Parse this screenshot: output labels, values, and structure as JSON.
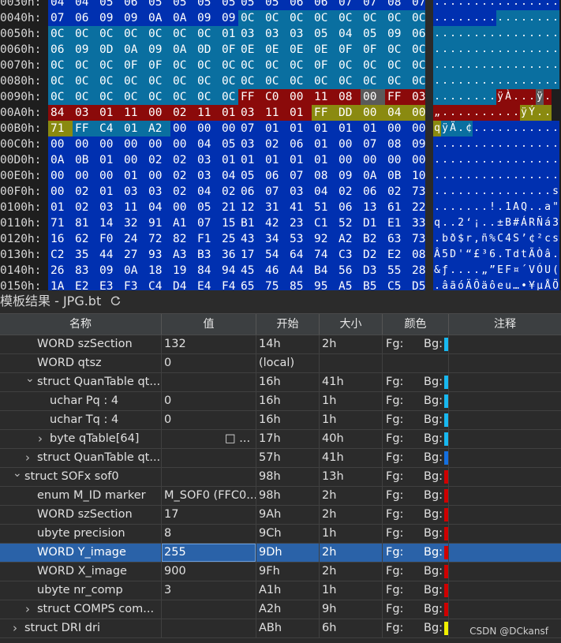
{
  "colors": {
    "blue": "#0030b0",
    "teal": "#0a6fa0",
    "red": "#8b0a0a",
    "yellow": "#8a8a10",
    "gray": "#5a5a5a",
    "swatch_cyan": "#18b8f0",
    "swatch_blue": "#1470e0",
    "swatch_red": "#d00000",
    "swatch_yellow": "#f0f000"
  },
  "hex": {
    "rows": [
      {
        "addr": "0030h:",
        "bytes": [
          "04",
          "04",
          "05",
          "06",
          "05",
          "05",
          "05",
          "05",
          "05",
          "05",
          "06",
          "06",
          "07",
          "07",
          "08",
          "07"
        ],
        "ascii": "................"
      },
      {
        "addr": "0040h:",
        "bytes": [
          "07",
          "06",
          "09",
          "09",
          "0A",
          "0A",
          "09",
          "09",
          "0C",
          "0C",
          "0C",
          "0C",
          "0C",
          "0C",
          "0C",
          "0C"
        ],
        "ascii": "................"
      },
      {
        "addr": "0050h:",
        "bytes": [
          "0C",
          "0C",
          "0C",
          "0C",
          "0C",
          "0C",
          "0C",
          "01",
          "03",
          "03",
          "03",
          "05",
          "04",
          "05",
          "09",
          "06"
        ],
        "ascii": "................"
      },
      {
        "addr": "0060h:",
        "bytes": [
          "06",
          "09",
          "0D",
          "0A",
          "09",
          "0A",
          "0D",
          "0F",
          "0E",
          "0E",
          "0E",
          "0E",
          "0F",
          "0F",
          "0C",
          "0C"
        ],
        "ascii": "................"
      },
      {
        "addr": "0070h:",
        "bytes": [
          "0C",
          "0C",
          "0C",
          "0F",
          "0F",
          "0C",
          "0C",
          "0C",
          "0C",
          "0C",
          "0C",
          "0F",
          "0C",
          "0C",
          "0C",
          "0C"
        ],
        "ascii": "................"
      },
      {
        "addr": "0080h:",
        "bytes": [
          "0C",
          "0C",
          "0C",
          "0C",
          "0C",
          "0C",
          "0C",
          "0C",
          "0C",
          "0C",
          "0C",
          "0C",
          "0C",
          "0C",
          "0C",
          "0C"
        ],
        "ascii": "................"
      },
      {
        "addr": "0090h:",
        "bytes": [
          "0C",
          "0C",
          "0C",
          "0C",
          "0C",
          "0C",
          "0C",
          "0C",
          "FF",
          "C0",
          "00",
          "11",
          "08",
          "00",
          "FF",
          "03"
        ],
        "ascii": "........ÿÀ...ÿ."
      },
      {
        "addr": "00A0h:",
        "bytes": [
          "84",
          "03",
          "01",
          "11",
          "00",
          "02",
          "11",
          "01",
          "03",
          "11",
          "01",
          "FF",
          "DD",
          "00",
          "04",
          "00"
        ],
        "ascii": "„..........ÿÝ.."
      },
      {
        "addr": "00B0h:",
        "bytes": [
          "71",
          "FF",
          "C4",
          "01",
          "A2",
          "00",
          "00",
          "00",
          "07",
          "01",
          "01",
          "01",
          "01",
          "01",
          "00",
          "00"
        ],
        "ascii": "qÿÄ.¢..........."
      },
      {
        "addr": "00C0h:",
        "bytes": [
          "00",
          "00",
          "00",
          "00",
          "00",
          "00",
          "04",
          "05",
          "03",
          "02",
          "06",
          "01",
          "00",
          "07",
          "08",
          "09"
        ],
        "ascii": "................"
      },
      {
        "addr": "00D0h:",
        "bytes": [
          "0A",
          "0B",
          "01",
          "00",
          "02",
          "02",
          "03",
          "01",
          "01",
          "01",
          "01",
          "01",
          "00",
          "00",
          "00",
          "00"
        ],
        "ascii": "................"
      },
      {
        "addr": "00E0h:",
        "bytes": [
          "00",
          "00",
          "00",
          "01",
          "00",
          "02",
          "03",
          "04",
          "05",
          "06",
          "07",
          "08",
          "09",
          "0A",
          "0B",
          "10"
        ],
        "ascii": "................"
      },
      {
        "addr": "00F0h:",
        "bytes": [
          "00",
          "02",
          "01",
          "03",
          "03",
          "02",
          "04",
          "02",
          "06",
          "07",
          "03",
          "04",
          "02",
          "06",
          "02",
          "73"
        ],
        "ascii": "...............s"
      },
      {
        "addr": "0100h:",
        "bytes": [
          "01",
          "02",
          "03",
          "11",
          "04",
          "00",
          "05",
          "21",
          "12",
          "31",
          "41",
          "51",
          "06",
          "13",
          "61",
          "22"
        ],
        "ascii": ".......!.1AQ..a\""
      },
      {
        "addr": "0110h:",
        "bytes": [
          "71",
          "81",
          "14",
          "32",
          "91",
          "A1",
          "07",
          "15",
          "B1",
          "42",
          "23",
          "C1",
          "52",
          "D1",
          "E1",
          "33"
        ],
        "ascii": "q..2‘¡..±B#ÁRÑá3"
      },
      {
        "addr": "0120h:",
        "bytes": [
          "16",
          "62",
          "F0",
          "24",
          "72",
          "82",
          "F1",
          "25",
          "43",
          "34",
          "53",
          "92",
          "A2",
          "B2",
          "63",
          "73"
        ],
        "ascii": ".bð$r‚ñ%C4S’¢²cs"
      },
      {
        "addr": "0130h:",
        "bytes": [
          "C2",
          "35",
          "44",
          "27",
          "93",
          "A3",
          "B3",
          "36",
          "17",
          "54",
          "64",
          "74",
          "C3",
          "D2",
          "E2",
          "08"
        ],
        "ascii": "Â5D'“£³6.TdtÃÒâ."
      },
      {
        "addr": "0140h:",
        "bytes": [
          "26",
          "83",
          "09",
          "0A",
          "18",
          "19",
          "84",
          "94",
          "45",
          "46",
          "A4",
          "B4",
          "56",
          "D3",
          "55",
          "28"
        ],
        "ascii": "&ƒ....„”EF¤´VÓU("
      },
      {
        "addr": "0150h:",
        "bytes": [
          "1A",
          "E2",
          "E3",
          "F3",
          "C4",
          "D4",
          "E4",
          "F4",
          "65",
          "75",
          "85",
          "95",
          "A5",
          "B5",
          "C5",
          "D5"
        ],
        "ascii": ".âãóÄÔäôeu…•¥µÅÕ"
      }
    ]
  },
  "panel": {
    "title": "模板结果 - JPG.bt",
    "columns": [
      "名称",
      "值",
      "开始",
      "大小",
      "颜色",
      "注释"
    ],
    "fg_label": "Fg:",
    "bg_label": "Bg:",
    "rows": [
      {
        "name": "WORD szSection",
        "value": "132",
        "start": "14h",
        "size": "2h",
        "swatch": "cyan",
        "indent": 1,
        "chev": ""
      },
      {
        "name": "WORD qtsz",
        "value": "0",
        "start": "(local)",
        "size": "",
        "swatch": "",
        "indent": 1,
        "chev": ""
      },
      {
        "name": "struct QuanTable qt...",
        "value": "",
        "start": "16h",
        "size": "41h",
        "swatch": "cyan",
        "indent": 1,
        "chev": "v"
      },
      {
        "name": "uchar Pq : 4",
        "value": "0",
        "start": "16h",
        "size": "1h",
        "swatch": "cyan",
        "indent": 2,
        "chev": ""
      },
      {
        "name": "uchar Tq : 4",
        "value": "0",
        "start": "16h",
        "size": "1h",
        "swatch": "cyan",
        "indent": 2,
        "chev": ""
      },
      {
        "name": "byte qTable[64]",
        "value": "□ ...",
        "start": "17h",
        "size": "40h",
        "swatch": "cyan",
        "indent": 2,
        "chev": ">"
      },
      {
        "name": "struct QuanTable qt...",
        "value": "",
        "start": "57h",
        "size": "41h",
        "swatch": "blue",
        "indent": 1,
        "chev": ">"
      },
      {
        "name": "struct SOFx sof0",
        "value": "",
        "start": "98h",
        "size": "13h",
        "swatch": "red",
        "indent": 0,
        "chev": "v"
      },
      {
        "name": "enum M_ID marker",
        "value": "M_SOF0 (FFC0...",
        "start": "98h",
        "size": "2h",
        "swatch": "red",
        "indent": 1,
        "chev": ""
      },
      {
        "name": "WORD szSection",
        "value": "17",
        "start": "9Ah",
        "size": "2h",
        "swatch": "red",
        "indent": 1,
        "chev": ""
      },
      {
        "name": "ubyte precision",
        "value": "8",
        "start": "9Ch",
        "size": "1h",
        "swatch": "red",
        "indent": 1,
        "chev": ""
      },
      {
        "name": "WORD Y_image",
        "value": "255",
        "start": "9Dh",
        "size": "2h",
        "swatch": "red",
        "indent": 1,
        "chev": "",
        "selected": true
      },
      {
        "name": "WORD X_image",
        "value": "900",
        "start": "9Fh",
        "size": "2h",
        "swatch": "red",
        "indent": 1,
        "chev": ""
      },
      {
        "name": "ubyte nr_comp",
        "value": "3",
        "start": "A1h",
        "size": "1h",
        "swatch": "red",
        "indent": 1,
        "chev": ""
      },
      {
        "name": "struct COMPS com...",
        "value": "",
        "start": "A2h",
        "size": "9h",
        "swatch": "red",
        "indent": 1,
        "chev": ">"
      },
      {
        "name": "struct DRI dri",
        "value": "",
        "start": "ABh",
        "size": "6h",
        "swatch": "yellow",
        "indent": 0,
        "chev": ">"
      }
    ]
  },
  "watermark": "CSDN @DCkansf"
}
